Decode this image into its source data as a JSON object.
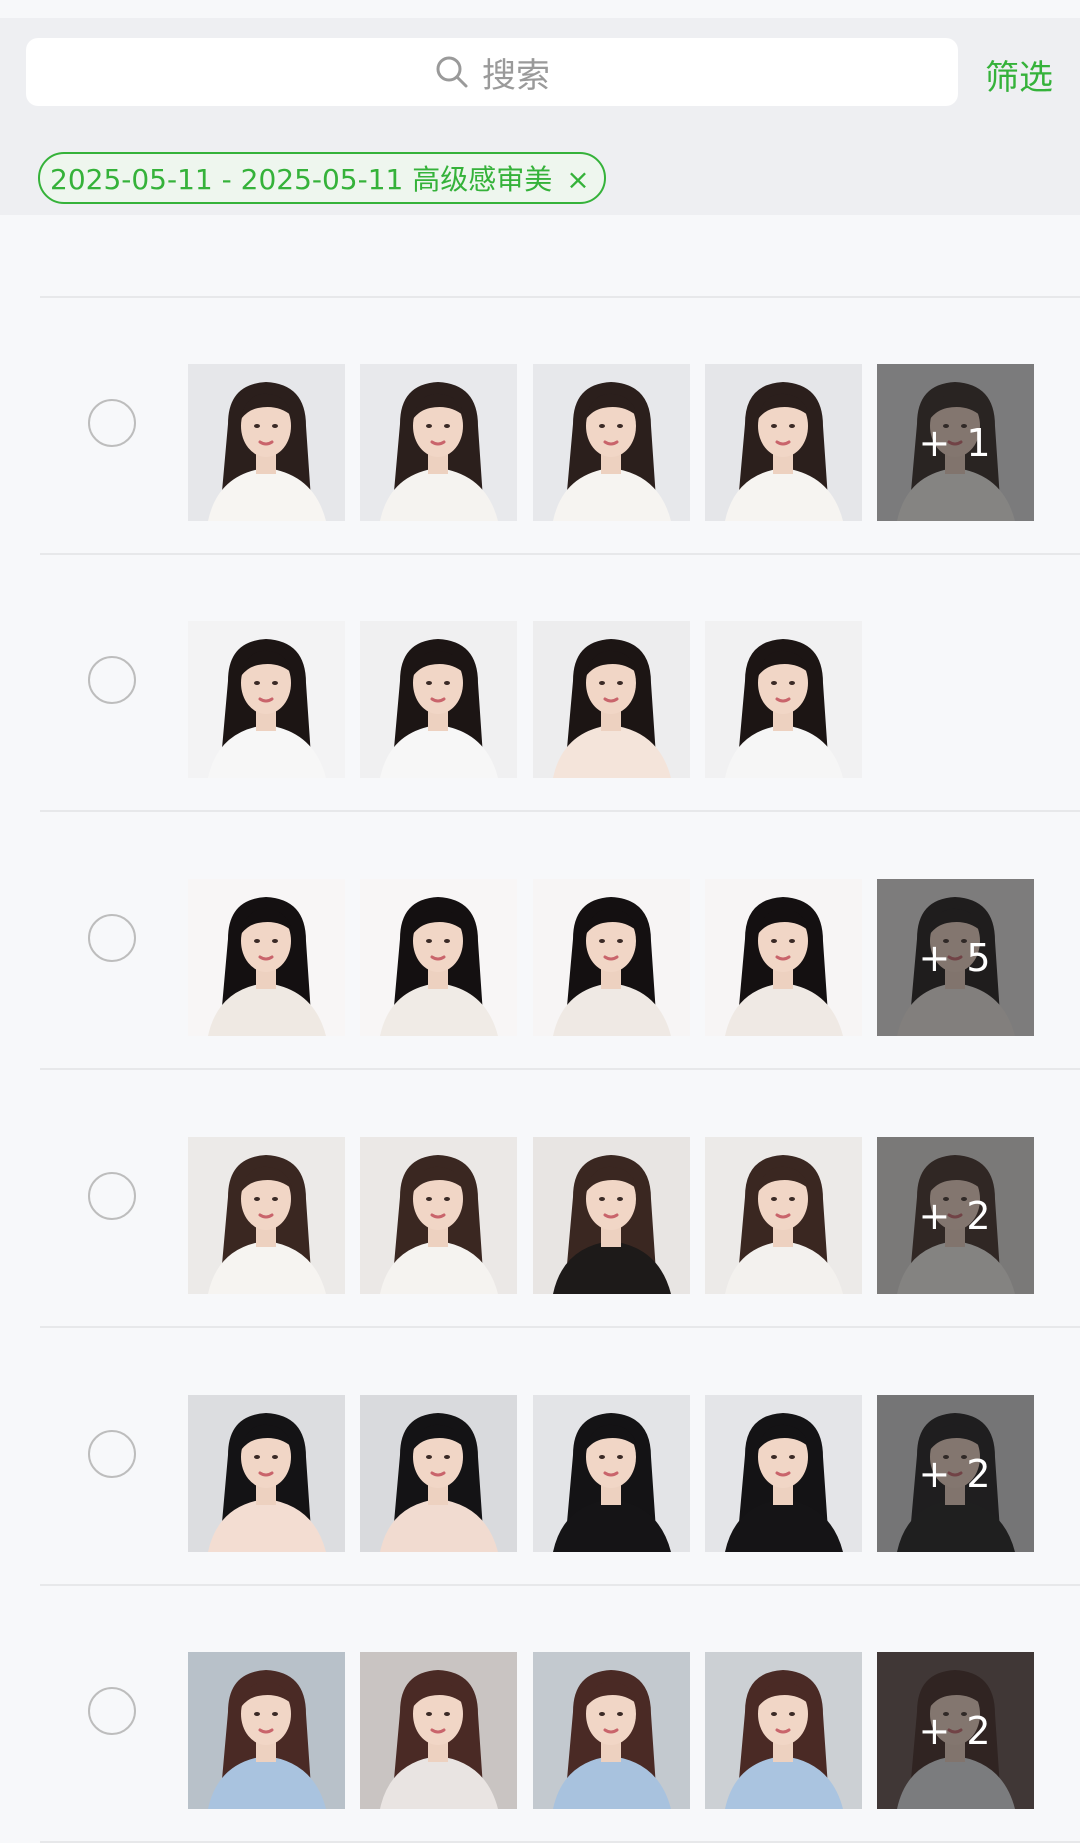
{
  "search": {
    "placeholder": "搜索",
    "icon": "search-icon"
  },
  "filter": {
    "label": "筛选"
  },
  "active_filter": {
    "label": "2025-05-11 - 2025-05-11 高级感审美",
    "close": "×"
  },
  "colors": {
    "accent": "#35b23a",
    "background": "#f7f8fa",
    "header": "#eeeff2"
  },
  "rows": [
    {
      "thumbs": 5,
      "more": "",
      "partial": true,
      "palette": [
        [
          "#caa77a",
          "#2b1d1a",
          "#f1d9c8"
        ],
        [
          "#e9dcd3",
          "#1d1615",
          "#f2dccc"
        ],
        [
          "#b6b6bf",
          "#2a201e",
          "#f0d8c6"
        ],
        [
          "#d7cfcb",
          "#1f1817",
          "#f2dcca"
        ],
        [
          "#e7e3e3",
          "#1e1716",
          "#efd6c4"
        ]
      ]
    },
    {
      "thumbs": 5,
      "more": "+ 1",
      "palette": [
        [
          "#e6e7ea",
          "#2b1f1c",
          "#f7f5f2"
        ],
        [
          "#e8e9ec",
          "#2b1f1c",
          "#f5f3f0"
        ],
        [
          "#e7e8eb",
          "#2b1f1c",
          "#f6f4f1"
        ],
        [
          "#e5e6e9",
          "#2b1f1c",
          "#f6f4f1"
        ],
        [
          "#dfe0e3",
          "#2b1f1c",
          "#f5f3f0"
        ]
      ]
    },
    {
      "thumbs": 4,
      "more": "",
      "palette": [
        [
          "#f3f3f4",
          "#1c1514",
          "#f7f7f7"
        ],
        [
          "#f0f0f1",
          "#1c1514",
          "#f7f7f7"
        ],
        [
          "#ededee",
          "#1c1514",
          "#f4e4da"
        ],
        [
          "#f1f1f2",
          "#1c1514",
          "#f6f6f6"
        ]
      ]
    },
    {
      "thumbs": 5,
      "more": "+ 5",
      "palette": [
        [
          "#f8f6f6",
          "#141011",
          "#efe9e3"
        ],
        [
          "#f8f6f6",
          "#141011",
          "#f0ebe6"
        ],
        [
          "#f7f5f5",
          "#141011",
          "#efe9e4"
        ],
        [
          "#f7f5f5",
          "#141011",
          "#efe9e4"
        ],
        [
          "#e4e2e2",
          "#141011",
          "#efe9e4"
        ]
      ]
    },
    {
      "thumbs": 5,
      "more": "+ 2",
      "palette": [
        [
          "#eceae8",
          "#3a2721",
          "#f6f4f1"
        ],
        [
          "#ebe8e6",
          "#3a2721",
          "#f5f3f0"
        ],
        [
          "#e8e5e3",
          "#3a2721",
          "#1d1a19"
        ],
        [
          "#eceae8",
          "#3a2721",
          "#f3f1ee"
        ],
        [
          "#dedbd9",
          "#3a2721",
          "#f3f1ee"
        ]
      ]
    },
    {
      "thumbs": 5,
      "more": "+ 2",
      "palette": [
        [
          "#dcdde0",
          "#141315",
          "#f3ddd2"
        ],
        [
          "#d9dadd",
          "#141315",
          "#f1dbd0"
        ],
        [
          "#e3e4e7",
          "#141315",
          "#151416"
        ],
        [
          "#e4e5e8",
          "#141315",
          "#151416"
        ],
        [
          "#d2d3d6",
          "#141315",
          "#151416"
        ]
      ]
    },
    {
      "thumbs": 5,
      "more": "+ 2",
      "palette": [
        [
          "#b8c1c9",
          "#4a2a25",
          "#a9c3df"
        ],
        [
          "#c9c4c2",
          "#4a2a25",
          "#e9e4e2"
        ],
        [
          "#c3c9cf",
          "#4a2a25",
          "#a8c2de"
        ],
        [
          "#ccd0d4",
          "#4a2a25",
          "#aac4e0"
        ],
        [
          "#5d4a47",
          "#3a201c",
          "#dfe3e7"
        ]
      ]
    }
  ]
}
